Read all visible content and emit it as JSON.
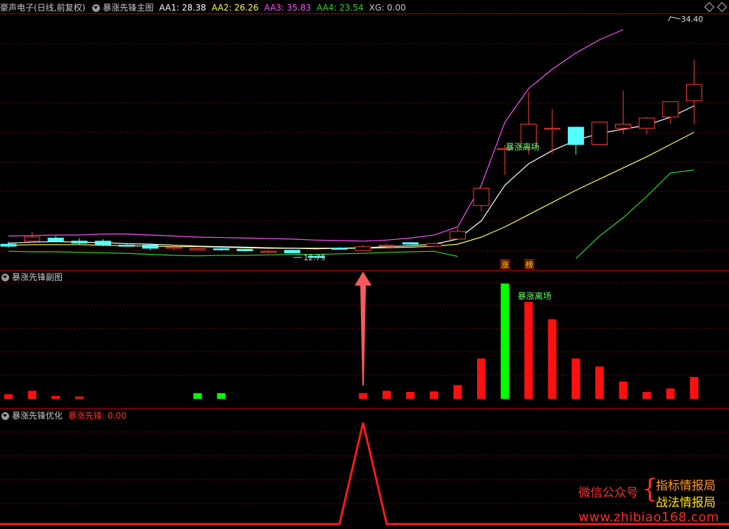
{
  "main_header": {
    "stock": "豪声电子(日线,前复权)",
    "indicator": "暴涨先锋主图",
    "aa1": "AA1: 28.38",
    "aa2": "AA2: 26.26",
    "aa3": "AA3: 35.83",
    "aa4": "AA4: 23.54",
    "xg": "XG: 0.00"
  },
  "sub_header": {
    "indicator": "暴涨先锋副图"
  },
  "opt_header": {
    "indicator": "暴涨先锋优化",
    "value": "暴涨先锋: 0.00"
  },
  "watermark": {
    "left": "微信公众号",
    "brace": "{",
    "right1": "指标情报局",
    "right2": "战法情报局",
    "url": "www.zhibiao168.com"
  },
  "colors": {
    "up": "#ff3c3c",
    "down": "#54ffff",
    "aa1": "#ffffff",
    "aa2": "#ffff50",
    "aa3": "#ff50ff",
    "aa4": "#2ad62a",
    "grid": "#7a0000",
    "border": "#a00000",
    "bar_green": "#00ff00",
    "peak": "#ff1a1a",
    "label_green": "#60ff60"
  },
  "chart_data": {
    "type": "candlestick",
    "annotations": {
      "high_label": "34.40",
      "low_label": "12.79",
      "exit_label_main": "暴涨离场",
      "exit_label_sub": "暴涨离场",
      "badge1": "涨",
      "badge2": "榜"
    },
    "candles": [
      {
        "o": 14.2,
        "h": 14.45,
        "l": 13.85,
        "c": 14.0
      },
      {
        "o": 14.5,
        "h": 15.4,
        "l": 14.3,
        "c": 14.9
      },
      {
        "o": 14.8,
        "h": 15.0,
        "l": 14.4,
        "c": 14.5
      },
      {
        "o": 14.5,
        "h": 14.8,
        "l": 14.1,
        "c": 14.3
      },
      {
        "o": 14.5,
        "h": 14.7,
        "l": 14.0,
        "c": 14.15
      },
      {
        "o": 14.1,
        "h": 14.25,
        "l": 13.95,
        "c": 14.05
      },
      {
        "o": 14.1,
        "h": 14.3,
        "l": 13.6,
        "c": 13.8
      },
      {
        "o": 13.8,
        "h": 14.0,
        "l": 13.6,
        "c": 13.9
      },
      {
        "o": 13.7,
        "h": 13.8,
        "l": 13.6,
        "c": 13.75
      },
      {
        "o": 13.75,
        "h": 13.8,
        "l": 13.55,
        "c": 13.65
      },
      {
        "o": 13.7,
        "h": 13.75,
        "l": 13.45,
        "c": 13.55
      },
      {
        "o": 13.4,
        "h": 13.6,
        "l": 13.3,
        "c": 13.5
      },
      {
        "o": 13.6,
        "h": 13.65,
        "l": 13.3,
        "c": 13.35
      },
      {
        "o": 13.0,
        "h": 13.05,
        "l": 12.79,
        "c": 12.9
      },
      {
        "o": 13.8,
        "h": 13.9,
        "l": 13.65,
        "c": 13.75
      },
      {
        "o": 13.55,
        "h": 14.15,
        "l": 13.5,
        "c": 13.95
      },
      {
        "o": 14.0,
        "h": 14.2,
        "l": 13.9,
        "c": 14.1
      },
      {
        "o": 14.35,
        "h": 14.4,
        "l": 14.15,
        "c": 14.2
      },
      {
        "o": 14.0,
        "h": 14.4,
        "l": 13.95,
        "c": 14.25
      },
      {
        "o": 14.7,
        "h": 15.8,
        "l": 14.6,
        "c": 15.45
      },
      {
        "o": 18.0,
        "h": 19.7,
        "l": 17.4,
        "c": 19.7
      },
      {
        "o": 23.6,
        "h": 24.0,
        "l": 21.0,
        "c": 23.6
      },
      {
        "o": 23.7,
        "h": 29.2,
        "l": 23.0,
        "c": 26.0
      },
      {
        "o": 25.6,
        "h": 27.5,
        "l": 23.1,
        "c": 25.6
      },
      {
        "o": 25.7,
        "h": 25.75,
        "l": 23.0,
        "c": 24.0
      },
      {
        "o": 24.0,
        "h": 26.2,
        "l": 24.0,
        "c": 26.2
      },
      {
        "o": 25.6,
        "h": 29.3,
        "l": 25.0,
        "c": 26.0
      },
      {
        "o": 25.6,
        "h": 26.7,
        "l": 25.0,
        "c": 26.6
      },
      {
        "o": 26.7,
        "h": 28.2,
        "l": 26.0,
        "c": 28.2
      },
      {
        "o": 28.3,
        "h": 32.3,
        "l": 26.0,
        "c": 29.9
      }
    ],
    "aa3": [
      15.0,
      15.05,
      15.1,
      15.1,
      15.2,
      15.2,
      15.1,
      15.0,
      14.9,
      14.85,
      14.8,
      14.75,
      14.7,
      14.6,
      14.55,
      14.5,
      14.6,
      14.8,
      15.1,
      15.9,
      20.0,
      26.2,
      29.5,
      31.4,
      33.0,
      34.3,
      35.3,
      null,
      null,
      null
    ],
    "aa1": [
      14.3,
      14.4,
      14.45,
      14.4,
      14.35,
      14.25,
      14.2,
      14.1,
      14.0,
      13.95,
      13.9,
      13.85,
      13.8,
      13.75,
      13.8,
      13.85,
      13.95,
      14.05,
      14.2,
      14.7,
      16.5,
      20.0,
      22.1,
      23.4,
      24.4,
      25.1,
      25.5,
      25.9,
      26.7,
      27.8
    ],
    "aa2": [
      14.1,
      14.15,
      14.15,
      14.15,
      14.1,
      14.05,
      14.0,
      13.95,
      13.95,
      13.9,
      13.85,
      13.8,
      13.8,
      13.8,
      13.8,
      13.8,
      13.85,
      13.9,
      14.0,
      14.2,
      14.9,
      15.9,
      17.1,
      18.3,
      19.5,
      20.6,
      21.7,
      22.8,
      24.0,
      25.2
    ],
    "aa4": [
      13.5,
      13.45,
      13.45,
      13.4,
      13.35,
      13.3,
      13.2,
      13.1,
      13.05,
      13.1,
      13.1,
      13.15,
      13.2,
      13.2,
      13.25,
      13.3,
      13.4,
      13.45,
      13.5,
      13.0,
      null,
      null,
      null,
      null,
      12.8,
      15.0,
      16.8,
      18.9,
      21.2,
      21.5
    ],
    "sub_bars": [
      {
        "i": 0,
        "v": 0.04,
        "c": "red"
      },
      {
        "i": 1,
        "v": 0.07,
        "c": "red"
      },
      {
        "i": 2,
        "v": 0.025,
        "c": "red"
      },
      {
        "i": 3,
        "v": 0.02,
        "c": "red"
      },
      {
        "i": 8,
        "v": 0.05,
        "c": "green"
      },
      {
        "i": 9,
        "v": 0.05,
        "c": "green"
      },
      {
        "i": 15,
        "v": 0.05,
        "c": "red"
      },
      {
        "i": 16,
        "v": 0.07,
        "c": "red"
      },
      {
        "i": 17,
        "v": 0.06,
        "c": "red"
      },
      {
        "i": 18,
        "v": 0.065,
        "c": "red"
      },
      {
        "i": 19,
        "v": 0.12,
        "c": "red"
      },
      {
        "i": 20,
        "v": 0.35,
        "c": "red"
      },
      {
        "i": 21,
        "v": 1.0,
        "c": "green"
      },
      {
        "i": 22,
        "v": 0.84,
        "c": "red"
      },
      {
        "i": 23,
        "v": 0.69,
        "c": "red"
      },
      {
        "i": 24,
        "v": 0.35,
        "c": "red"
      },
      {
        "i": 25,
        "v": 0.28,
        "c": "red"
      },
      {
        "i": 26,
        "v": 0.15,
        "c": "red"
      },
      {
        "i": 27,
        "v": 0.06,
        "c": "red"
      },
      {
        "i": 28,
        "v": 0.09,
        "c": "red"
      },
      {
        "i": 29,
        "v": 0.19,
        "c": "red"
      }
    ],
    "signal": {
      "peak_index": 15,
      "peak_value": 1,
      "baseline": 0
    }
  }
}
